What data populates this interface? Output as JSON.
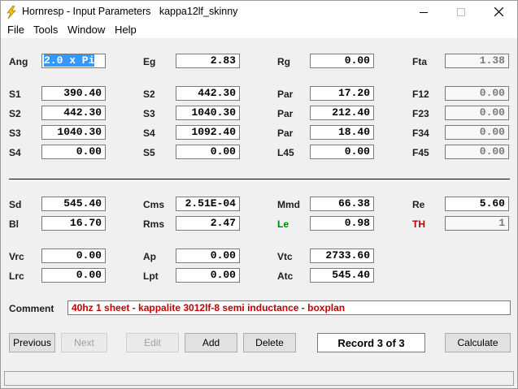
{
  "window": {
    "title": "Hornresp - Input Parameters   kappa12lf_skinny",
    "icon": "lightning-icon",
    "controls": [
      "minimize-icon",
      "maximize-icon",
      "close-icon"
    ]
  },
  "menu": [
    "File",
    "Tools",
    "Window",
    "Help"
  ],
  "params": {
    "Ang": {
      "label": "Ang",
      "value": "2.0 x Pi"
    },
    "Eg": {
      "label": "Eg",
      "value": "2.83"
    },
    "Rg": {
      "label": "Rg",
      "value": "0.00"
    },
    "Fta": {
      "label": "Fta",
      "value": "1.38"
    },
    "S1": {
      "label": "S1",
      "value": "390.40"
    },
    "S2a": {
      "label": "S2",
      "value": "442.30"
    },
    "Par1": {
      "label": "Par",
      "value": "17.20"
    },
    "F12": {
      "label": "F12",
      "value": "0.00"
    },
    "S2b": {
      "label": "S2",
      "value": "442.30"
    },
    "S3a": {
      "label": "S3",
      "value": "1040.30"
    },
    "Par2": {
      "label": "Par",
      "value": "212.40"
    },
    "F23": {
      "label": "F23",
      "value": "0.00"
    },
    "S3b": {
      "label": "S3",
      "value": "1040.30"
    },
    "S4a": {
      "label": "S4",
      "value": "1092.40"
    },
    "Par3": {
      "label": "Par",
      "value": "18.40"
    },
    "F34": {
      "label": "F34",
      "value": "0.00"
    },
    "S4b": {
      "label": "S4",
      "value": "0.00"
    },
    "S5": {
      "label": "S5",
      "value": "0.00"
    },
    "L45": {
      "label": "L45",
      "value": "0.00"
    },
    "F45": {
      "label": "F45",
      "value": "0.00"
    },
    "Sd": {
      "label": "Sd",
      "value": "545.40"
    },
    "Cms": {
      "label": "Cms",
      "value": "2.51E-04"
    },
    "Mmd": {
      "label": "Mmd",
      "value": "66.38"
    },
    "Re": {
      "label": "Re",
      "value": "5.60"
    },
    "Bl": {
      "label": "Bl",
      "value": "16.70"
    },
    "Rms": {
      "label": "Rms",
      "value": "2.47"
    },
    "Le": {
      "label": "Le",
      "value": "0.98"
    },
    "TH": {
      "label": "TH",
      "value": "1"
    },
    "Vrc": {
      "label": "Vrc",
      "value": "0.00"
    },
    "Ap": {
      "label": "Ap",
      "value": "0.00"
    },
    "Vtc": {
      "label": "Vtc",
      "value": "2733.60"
    },
    "Lrc": {
      "label": "Lrc",
      "value": "0.00"
    },
    "Lpt": {
      "label": "Lpt",
      "value": "0.00"
    },
    "Atc": {
      "label": "Atc",
      "value": "545.40"
    }
  },
  "colors": {
    "le_label": "#008000",
    "th_label": "#c00000",
    "comment_text": "#c00000",
    "selection": "#3399ff"
  },
  "comment": {
    "label": "Comment",
    "value": "40hz 1 sheet - kappalite 3012lf-8 semi inductance - boxplan"
  },
  "buttons": {
    "previous": "Previous",
    "next": "Next",
    "edit": "Edit",
    "add": "Add",
    "delete": "Delete",
    "calculate": "Calculate"
  },
  "record": "Record 3 of 3"
}
